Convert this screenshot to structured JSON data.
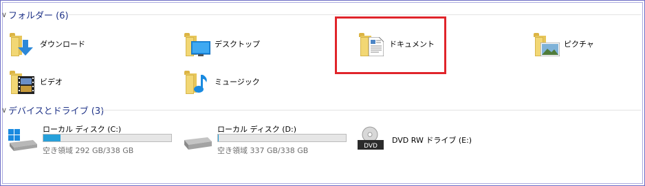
{
  "folders_section": {
    "title": "フォルダー (6)",
    "items": [
      {
        "label": "ダウンロード",
        "icon": "downloads-folder-icon"
      },
      {
        "label": "デスクトップ",
        "icon": "desktop-folder-icon"
      },
      {
        "label": "ドキュメント",
        "icon": "documents-folder-icon"
      },
      {
        "label": "ピクチャ",
        "icon": "pictures-folder-icon"
      },
      {
        "label": "ビデオ",
        "icon": "videos-folder-icon"
      },
      {
        "label": "ミュージック",
        "icon": "music-folder-icon"
      }
    ]
  },
  "drives_section": {
    "title": "デバイスとドライブ (3)",
    "drives": [
      {
        "label": "ローカル ディスク (C:)",
        "space": "空き領域 292 GB/338 GB",
        "used_fraction": 0.136,
        "icon": "windows-drive-icon"
      },
      {
        "label": "ローカル ディスク (D:)",
        "space": "空き領域 337 GB/338 GB",
        "used_fraction": 0.003,
        "icon": "drive-icon"
      },
      {
        "label": "DVD RW ドライブ (E:)",
        "icon": "dvd-drive-icon",
        "badge": "DVD"
      }
    ]
  },
  "colors": {
    "accent": "#26a0da",
    "highlight": "#e0242a",
    "section_title": "#1e3287"
  }
}
